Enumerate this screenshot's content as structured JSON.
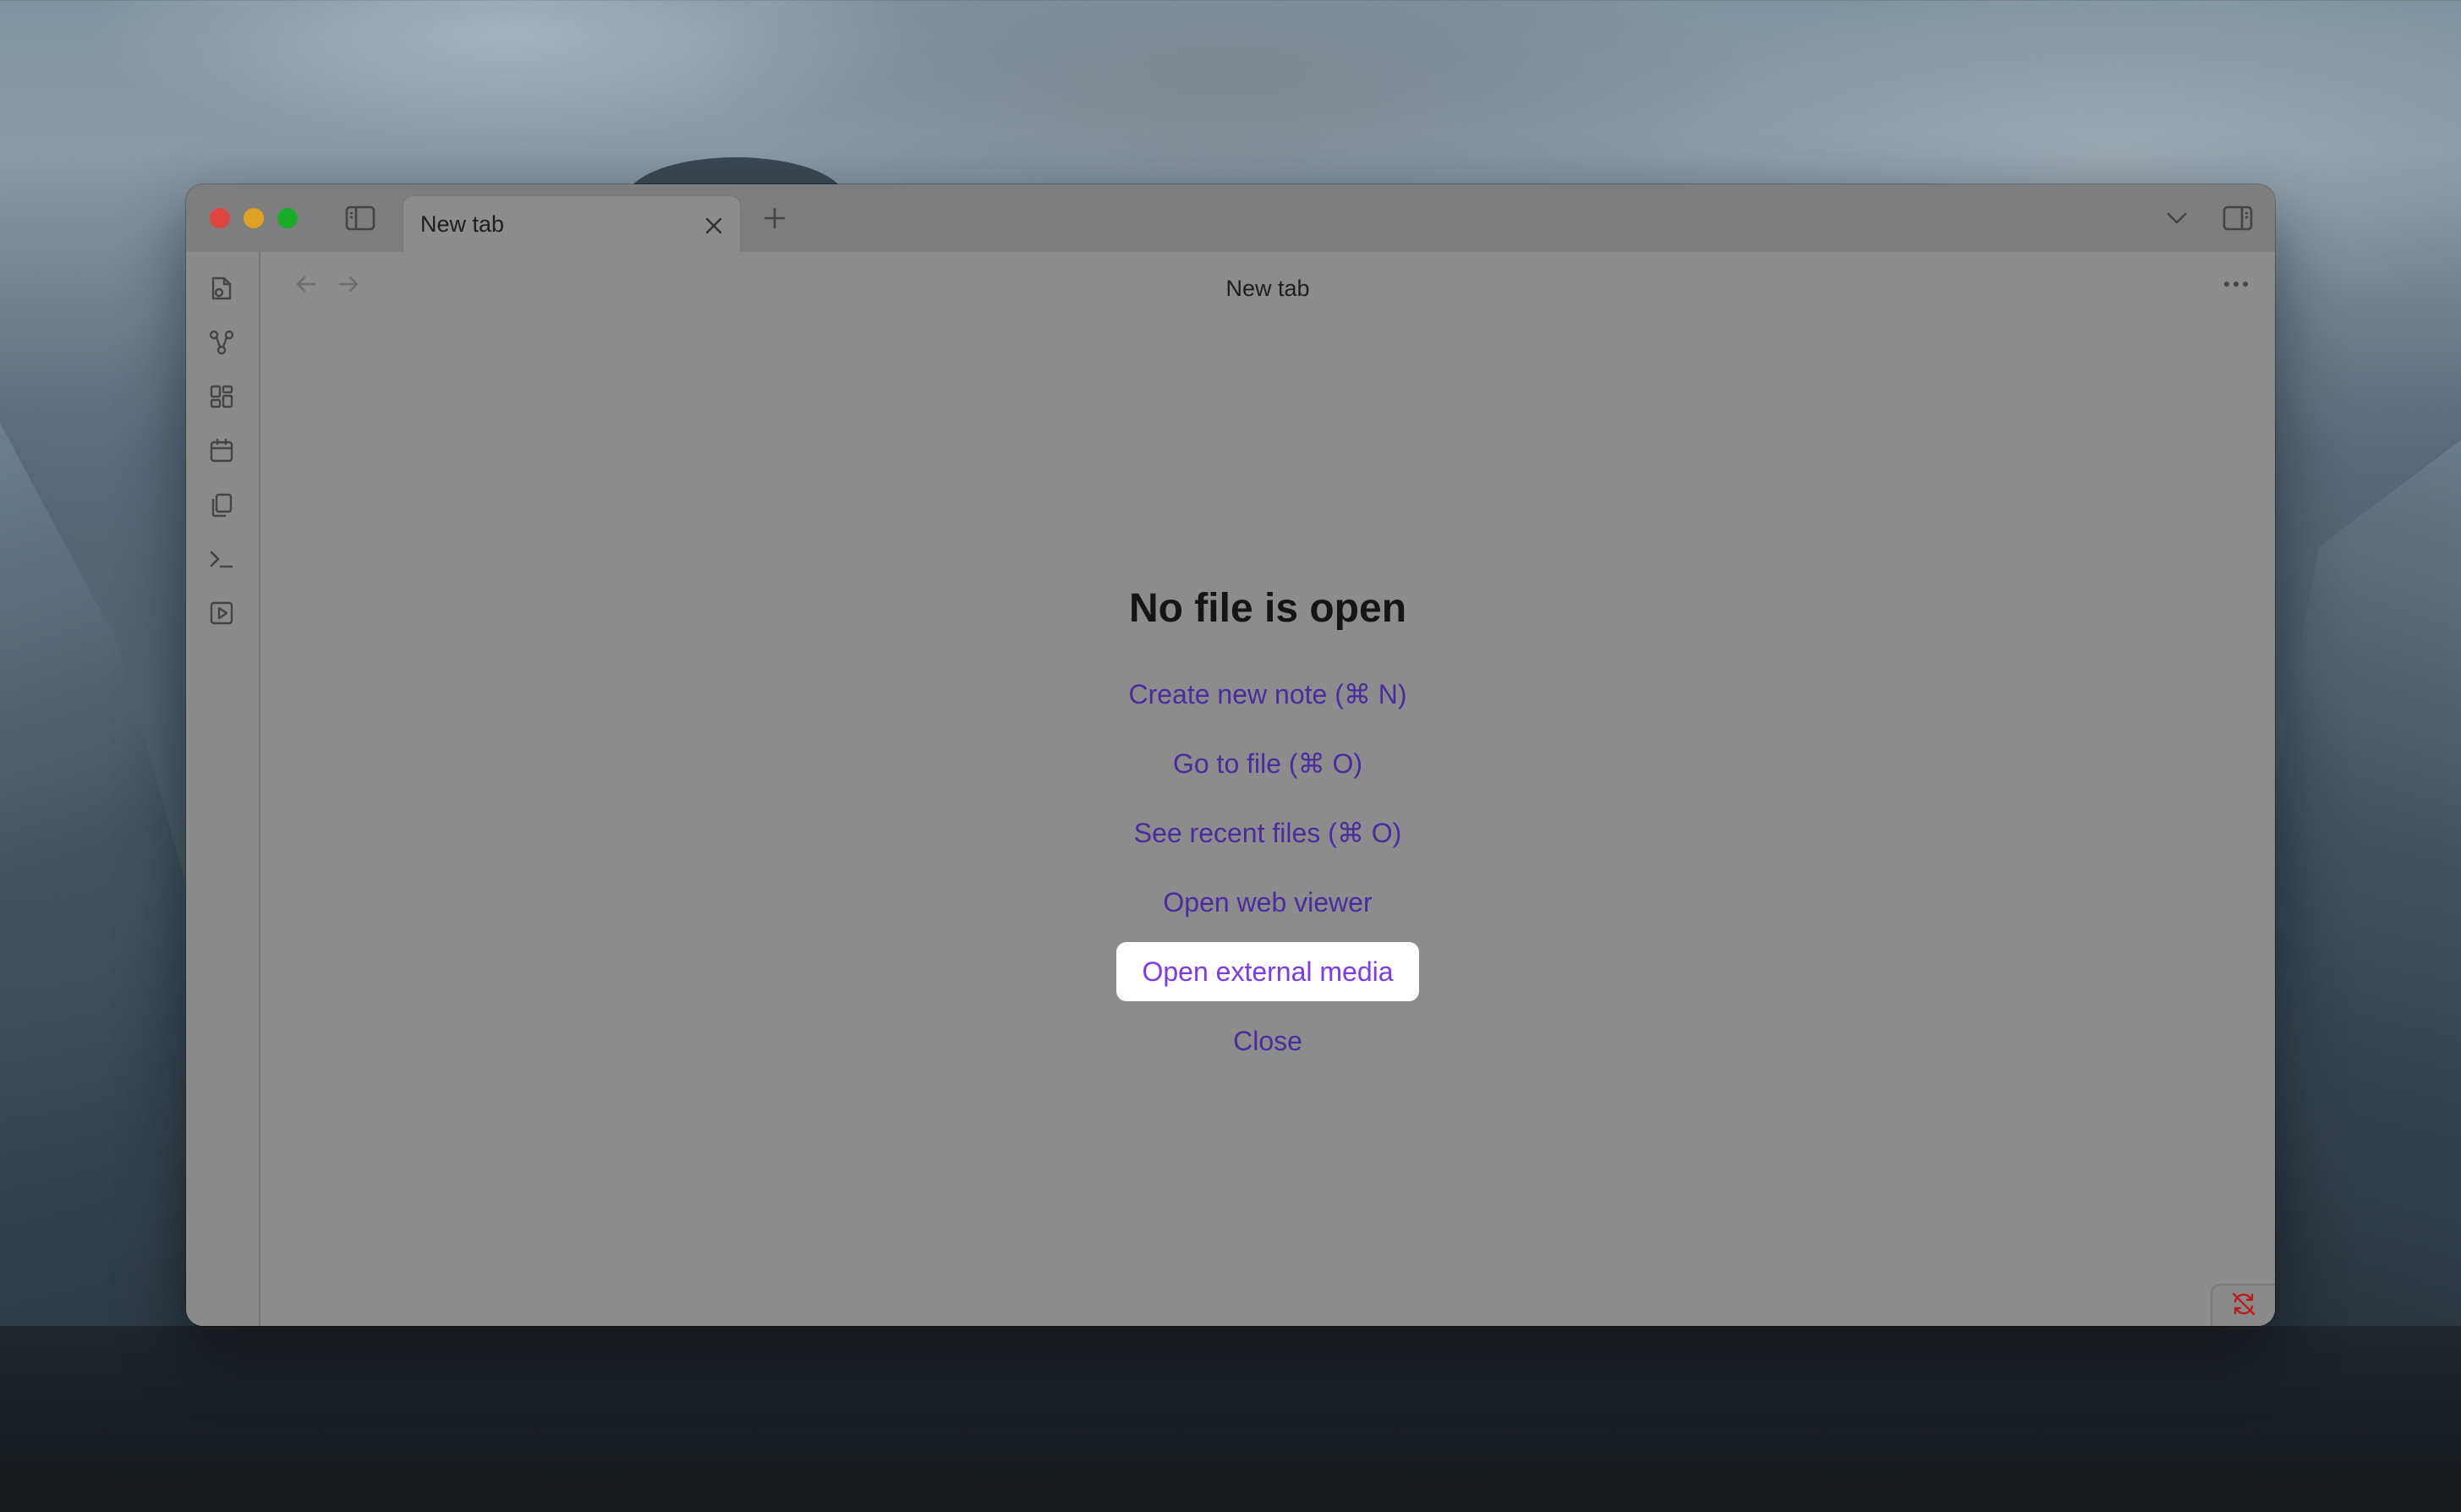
{
  "window": {
    "tab": {
      "label": "New tab"
    },
    "view_title": "New tab"
  },
  "empty_state": {
    "title": "No file is open",
    "actions": [
      {
        "label": "Create new note (⌘ N)"
      },
      {
        "label": "Go to file (⌘ O)"
      },
      {
        "label": "See recent files (⌘ O)"
      },
      {
        "label": "Open web viewer"
      },
      {
        "label": "Open external media",
        "highlighted": true
      },
      {
        "label": "Close"
      }
    ]
  },
  "ribbon": {
    "icons": [
      "file-plus-icon",
      "graph-icon",
      "dashboard-icon",
      "calendar-icon",
      "copy-icon",
      "terminal-icon",
      "play-icon"
    ]
  },
  "icons": {
    "sidebar_toggle": "sidebar-left-icon",
    "close_tab": "close-icon",
    "new_tab": "plus-icon",
    "tab_list": "chevron-down-icon",
    "right_sidebar": "sidebar-right-icon",
    "back": "arrow-left-icon",
    "forward": "arrow-right-icon",
    "more": "more-horizontal-icon",
    "sync": "sync-off-icon"
  },
  "colors": {
    "accent": "#7c3aed",
    "link": "#4b2c9f",
    "sync_error": "#b91c1c"
  }
}
